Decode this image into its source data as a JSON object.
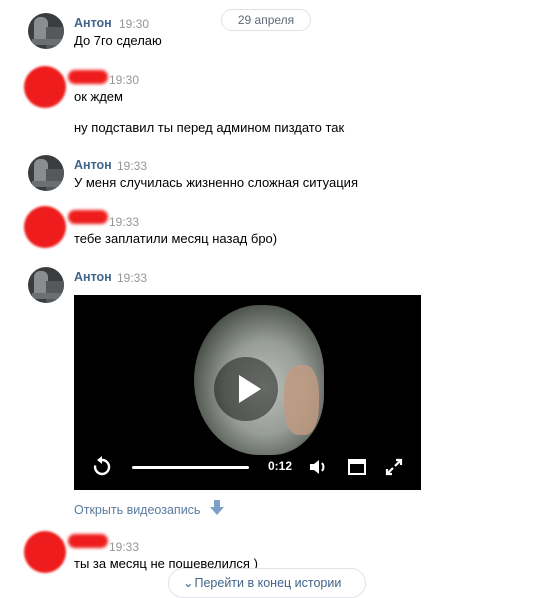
{
  "date_separator": "29 апреля",
  "messages": [
    {
      "author": "Антон",
      "time": "19:30",
      "lines": [
        "До 7го сделаю"
      ]
    },
    {
      "author": "",
      "time": "19:30",
      "lines": [
        "ок ждем",
        "ну подставил ты перед админом пиздато так"
      ]
    },
    {
      "author": "Антон",
      "time": "19:33",
      "lines": [
        "У меня случилась жизненно сложная ситуация"
      ]
    },
    {
      "author": "",
      "time": "19:33",
      "lines": [
        "тебе заплатили месяц назад бро)"
      ]
    },
    {
      "author": "Антон",
      "time": "19:33",
      "video": {
        "duration": "0:12",
        "progress": 1.0
      }
    },
    {
      "author": "",
      "time": "19:33",
      "lines": [
        "ты за месяц не пошевелился )"
      ]
    }
  ],
  "open_video_label": "Открыть видеозапись",
  "jump_to_end_label": "Перейти в конец истории",
  "colors": {
    "author": "#42648b",
    "time": "#939699",
    "link": "#5b7b9e",
    "redaction": "#ee1c1c"
  }
}
